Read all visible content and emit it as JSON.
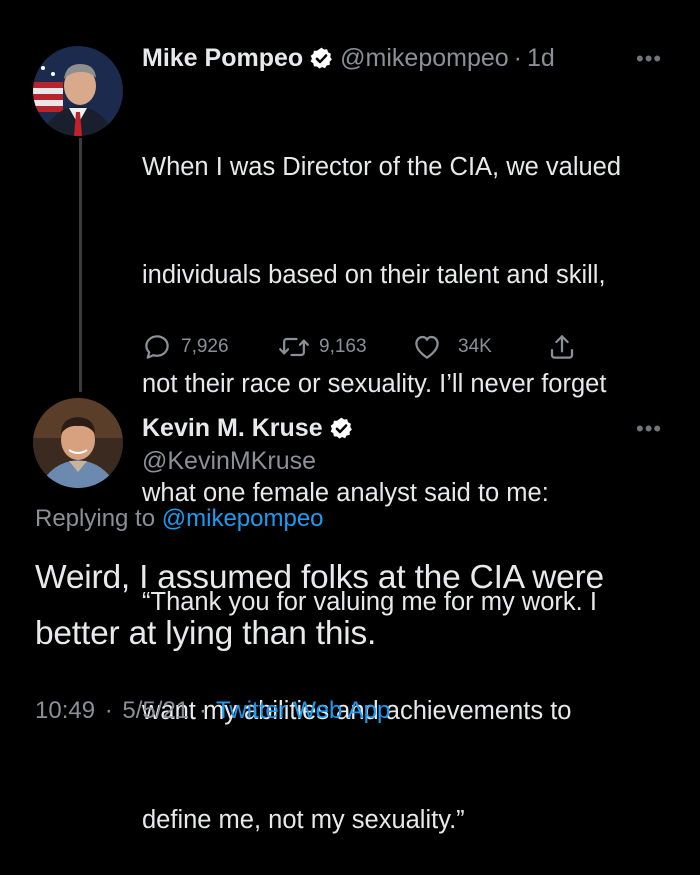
{
  "colors": {
    "background": "#000000",
    "text": "#e7e9ea",
    "muted": "#8b9096",
    "link": "#1d9bf0",
    "verified": "#ffffff"
  },
  "tweet1": {
    "display_name": "Mike Pompeo",
    "handle": "@mikepompeo",
    "separator": "·",
    "age": "1d",
    "more_icon": "more-horizontal-icon",
    "verified_icon": "verified-badge-icon",
    "body_lines": [
      "When I was Director of the CIA, we valued",
      "individuals based on their talent and skill,",
      "not their race or sexuality. I’ll never forget",
      "what one female analyst said to me:",
      "“Thank you for valuing me for my work. I",
      "want my abilities and achievements to",
      "define me, not my sexuality.”"
    ],
    "actions": {
      "reply_icon": "reply-icon",
      "reply_count": "7,926",
      "retweet_icon": "retweet-icon",
      "retweet_count": "9,163",
      "like_icon": "like-icon",
      "like_count": "34K",
      "share_icon": "share-icon"
    }
  },
  "tweet2": {
    "display_name": "Kevin M. Kruse",
    "handle": "@KevinMKruse",
    "more_icon": "more-horizontal-icon",
    "verified_icon": "verified-badge-icon",
    "replying_prefix": "Replying to ",
    "replying_to": "@mikepompeo",
    "body_lines": [
      "Weird, I assumed folks at the CIA were",
      "better at lying than this."
    ],
    "time": "10:49",
    "date": "5/5/21",
    "separator": "·",
    "source": "Twitter Web App"
  }
}
